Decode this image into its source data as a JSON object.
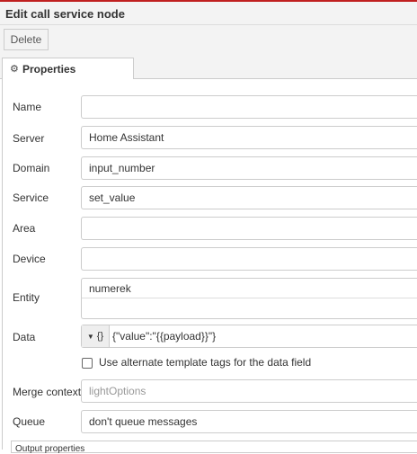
{
  "header": {
    "title": "Edit call service node"
  },
  "toolbar": {
    "delete_label": "Delete"
  },
  "tabs": [
    {
      "label": "Properties",
      "icon": "gear-icon"
    }
  ],
  "form": {
    "name": {
      "label": "Name",
      "value": ""
    },
    "server": {
      "label": "Server",
      "value": "Home Assistant"
    },
    "domain": {
      "label": "Domain",
      "value": "input_number"
    },
    "service": {
      "label": "Service",
      "value": "set_value"
    },
    "area": {
      "label": "Area",
      "value": ""
    },
    "device": {
      "label": "Device",
      "value": ""
    },
    "entity": {
      "label": "Entity",
      "tags": [
        "numerek"
      ]
    },
    "data": {
      "label": "Data",
      "type_symbol": "{}",
      "value": "{\"value\":\"{{payload}}\"}"
    },
    "alt_tags": {
      "label": "Use alternate template tags for the data field",
      "checked": false
    },
    "merge_context": {
      "label": "Merge context",
      "placeholder": "lightOptions"
    },
    "queue": {
      "label": "Queue",
      "value": "don't queue messages"
    }
  },
  "output": {
    "label": "Output properties"
  },
  "colors": {
    "accent_line": "#c02020",
    "toolbar_bg": "#f3f3f3",
    "border": "#cccccc"
  }
}
